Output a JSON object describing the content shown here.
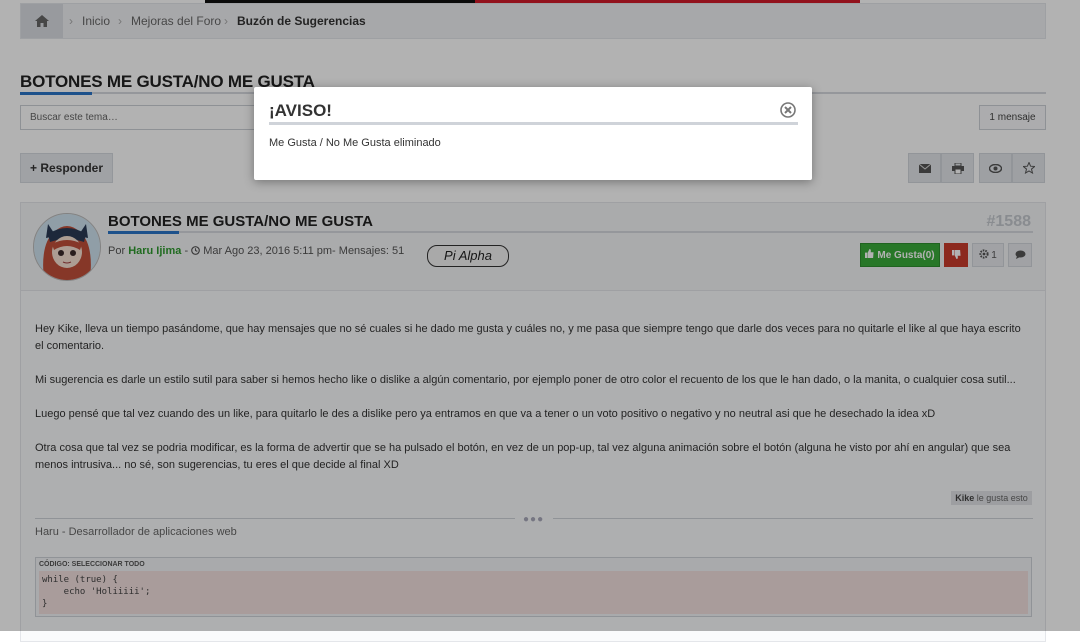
{
  "breadcrumb": {
    "home_icon": "home-icon",
    "items": [
      "Inicio",
      "Mejoras del Foro",
      "Buzón de Sugerencias"
    ]
  },
  "topic": {
    "title": "BOTONES ME GUSTA/NO ME GUSTA",
    "search_placeholder": "Buscar este tema…",
    "post_count": "1 mensaje",
    "reply_label": "Responder"
  },
  "toolbar": {
    "icons": [
      "envelope-icon",
      "print-icon",
      "eye-icon",
      "star-icon"
    ]
  },
  "post": {
    "title": "BOTONES ME GUSTA/NO ME GUSTA",
    "number": "#1588",
    "meta_prefix": "Por",
    "author": "Haru Ijima",
    "meta_rest": "Mar Ago 23, 2016 5:11 pm- Mensajes: 51",
    "rank": "Pi Alpha",
    "like_label": "Me Gusta(0)",
    "gear_count": "1",
    "paragraphs": [
      "Hey Kike, lleva un tiempo pasándome, que hay mensajes que no sé cuales si he dado me gusta y cuáles no, y me pasa que siempre tengo que darle dos veces para no quitarle el like al que haya escrito el comentario.",
      "Mi sugerencia es darle un estilo sutil para saber si hemos hecho like o dislike a algún comentario, por ejemplo poner de otro color el recuento de los que le han dado, o la manita, o cualquier cosa sutil...",
      "Luego pensé que tal vez cuando des un like, para quitarlo le des a dislike pero ya entramos en que va a tener o un voto positivo o negativo y no neutral asi que he desechado la idea xD",
      "Otra cosa que tal vez se podria modificar, es la forma de advertir que se ha pulsado el botón, en vez de un pop-up, tal vez alguna animación sobre el botón (alguna he visto por ahí en angular) que sea menos intrusiva... no sé, son sugerencias, tu eres el que decide al final XD"
    ],
    "likes_user": "Kike",
    "likes_text": "le gusta esto",
    "signature": "Haru - Desarrollador de aplicaciones web",
    "code_label": "CÓDIGO: SELECCIONAR TODO",
    "code": "while (true) {\n    echo 'Holiiiii';\n}"
  },
  "modal": {
    "title": "¡AVISO!",
    "message": "Me Gusta / No Me Gusta eliminado",
    "close_icon": "close-circle-icon"
  },
  "colors": {
    "accent_blue": "#2a74c7",
    "like_green": "#3aab3a",
    "dislike_red": "#c93c2b",
    "author_green": "#2f9a2f"
  }
}
